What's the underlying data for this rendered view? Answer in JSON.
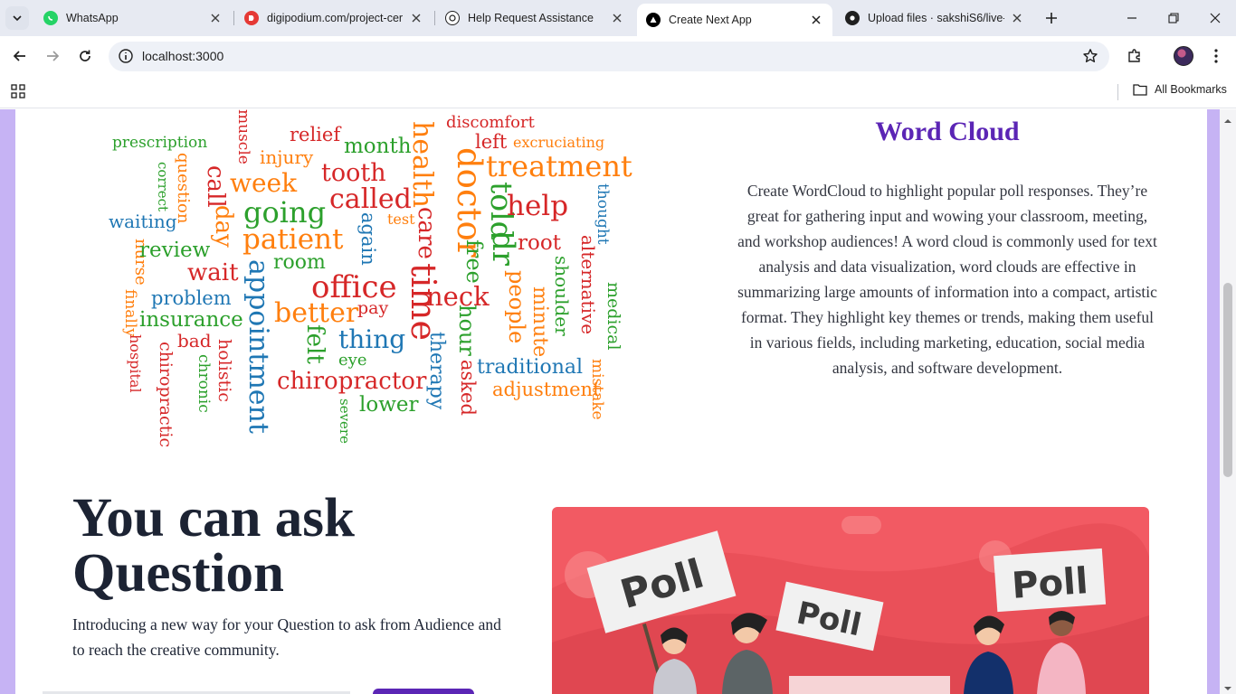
{
  "browser": {
    "tabs": [
      {
        "title": "WhatsApp",
        "icon": "whatsapp-icon"
      },
      {
        "title": "digipodium.com/project-cer",
        "icon": "digipodium-icon"
      },
      {
        "title": "Help Request Assistance",
        "icon": "openai-icon"
      },
      {
        "title": "Create Next App",
        "icon": "nextjs-icon",
        "active": true
      },
      {
        "title": "Upload files · sakshiS6/live-p",
        "icon": "github-icon"
      }
    ],
    "url": "localhost:3000",
    "bookmarks_label": "All Bookmarks"
  },
  "wordcloud": {
    "heading": "Word Cloud",
    "description": "Create WordCloud to highlight popular poll responses. They’re great for gathering input and wowing your classroom, meeting, and workshop audiences! A word cloud is commonly used for text analysis and data visualization, word clouds are effective in summarizing large amounts of information into a compact, artistic format. They highlight key themes or trends, making them useful in various fields, including marketing, education, social media analysis, and software development.",
    "words": [
      {
        "text": "muscle",
        "color": "red",
        "vertical": true
      },
      {
        "text": "discomfort",
        "color": "red"
      },
      {
        "text": "prescription",
        "color": "green"
      },
      {
        "text": "relief",
        "color": "red"
      },
      {
        "text": "month",
        "color": "green"
      },
      {
        "text": "health",
        "color": "orange",
        "vertical": true
      },
      {
        "text": "left",
        "color": "red"
      },
      {
        "text": "excruciating",
        "color": "orange"
      },
      {
        "text": "injury",
        "color": "orange"
      },
      {
        "text": "correct",
        "color": "green",
        "vertical": true
      },
      {
        "text": "question",
        "color": "orange",
        "vertical": true
      },
      {
        "text": "call",
        "color": "red",
        "vertical": true
      },
      {
        "text": "tooth",
        "color": "red"
      },
      {
        "text": "doctor",
        "color": "orange",
        "vertical": true
      },
      {
        "text": "treatment",
        "color": "orange"
      },
      {
        "text": "week",
        "color": "orange"
      },
      {
        "text": "told",
        "color": "green",
        "vertical": true
      },
      {
        "text": "thought",
        "color": "blue",
        "vertical": true
      },
      {
        "text": "called",
        "color": "red"
      },
      {
        "text": "help",
        "color": "red"
      },
      {
        "text": "going",
        "color": "green"
      },
      {
        "text": "waiting",
        "color": "blue"
      },
      {
        "text": "day",
        "color": "orange",
        "vertical": true
      },
      {
        "text": "again",
        "color": "blue",
        "vertical": true
      },
      {
        "text": "test",
        "color": "orange"
      },
      {
        "text": "care",
        "color": "red",
        "vertical": true
      },
      {
        "text": "dr",
        "color": "green",
        "vertical": true
      },
      {
        "text": "patient",
        "color": "orange"
      },
      {
        "text": "root",
        "color": "red"
      },
      {
        "text": "nurse",
        "color": "orange",
        "vertical": true
      },
      {
        "text": "review",
        "color": "green"
      },
      {
        "text": "free",
        "color": "green",
        "vertical": true
      },
      {
        "text": "alternative",
        "color": "red",
        "vertical": true
      },
      {
        "text": "shoulder",
        "color": "green",
        "vertical": true
      },
      {
        "text": "room",
        "color": "green"
      },
      {
        "text": "wait",
        "color": "red"
      },
      {
        "text": "finally",
        "color": "orange",
        "vertical": true
      },
      {
        "text": "appointment",
        "color": "blue",
        "vertical": true
      },
      {
        "text": "office",
        "color": "red"
      },
      {
        "text": "time",
        "color": "red",
        "vertical": true
      },
      {
        "text": "people",
        "color": "orange",
        "vertical": true
      },
      {
        "text": "medical",
        "color": "green",
        "vertical": true
      },
      {
        "text": "problem",
        "color": "blue"
      },
      {
        "text": "neck",
        "color": "red"
      },
      {
        "text": "minute",
        "color": "orange",
        "vertical": true
      },
      {
        "text": "pay",
        "color": "red"
      },
      {
        "text": "insurance",
        "color": "green"
      },
      {
        "text": "better",
        "color": "orange"
      },
      {
        "text": "hour",
        "color": "green",
        "vertical": true
      },
      {
        "text": "felt",
        "color": "green",
        "vertical": true
      },
      {
        "text": "hospital",
        "color": "red",
        "vertical": true
      },
      {
        "text": "bad",
        "color": "red"
      },
      {
        "text": "thing",
        "color": "blue"
      },
      {
        "text": "holistic",
        "color": "red",
        "vertical": true
      },
      {
        "text": "chiropractic",
        "color": "red",
        "vertical": true
      },
      {
        "text": "therapy",
        "color": "blue",
        "vertical": true
      },
      {
        "text": "eye",
        "color": "green"
      },
      {
        "text": "traditional",
        "color": "blue"
      },
      {
        "text": "mistake",
        "color": "orange",
        "vertical": true
      },
      {
        "text": "chronic",
        "color": "green",
        "vertical": true
      },
      {
        "text": "asked",
        "color": "red",
        "vertical": true
      },
      {
        "text": "chiropractor",
        "color": "red"
      },
      {
        "text": "adjustment",
        "color": "orange"
      },
      {
        "text": "lower",
        "color": "green"
      },
      {
        "text": "severe",
        "color": "green",
        "vertical": true
      }
    ]
  },
  "ask": {
    "heading_line1": "You can ask",
    "heading_line2": "Question",
    "text": "Introducing a new way for your Question to ask from Audience and to reach the creative community."
  },
  "poll_image": {
    "signs": [
      "Poll",
      "Poll",
      "Poll"
    ]
  },
  "colors": {
    "accent": "#5b25b5",
    "viewport_bg": "#c6b3f4",
    "poll_bg": "#f25a63",
    "wc_orange": "#ff7f0e",
    "wc_red": "#d62728",
    "wc_green": "#2ca02c",
    "wc_blue": "#1f77b4"
  }
}
